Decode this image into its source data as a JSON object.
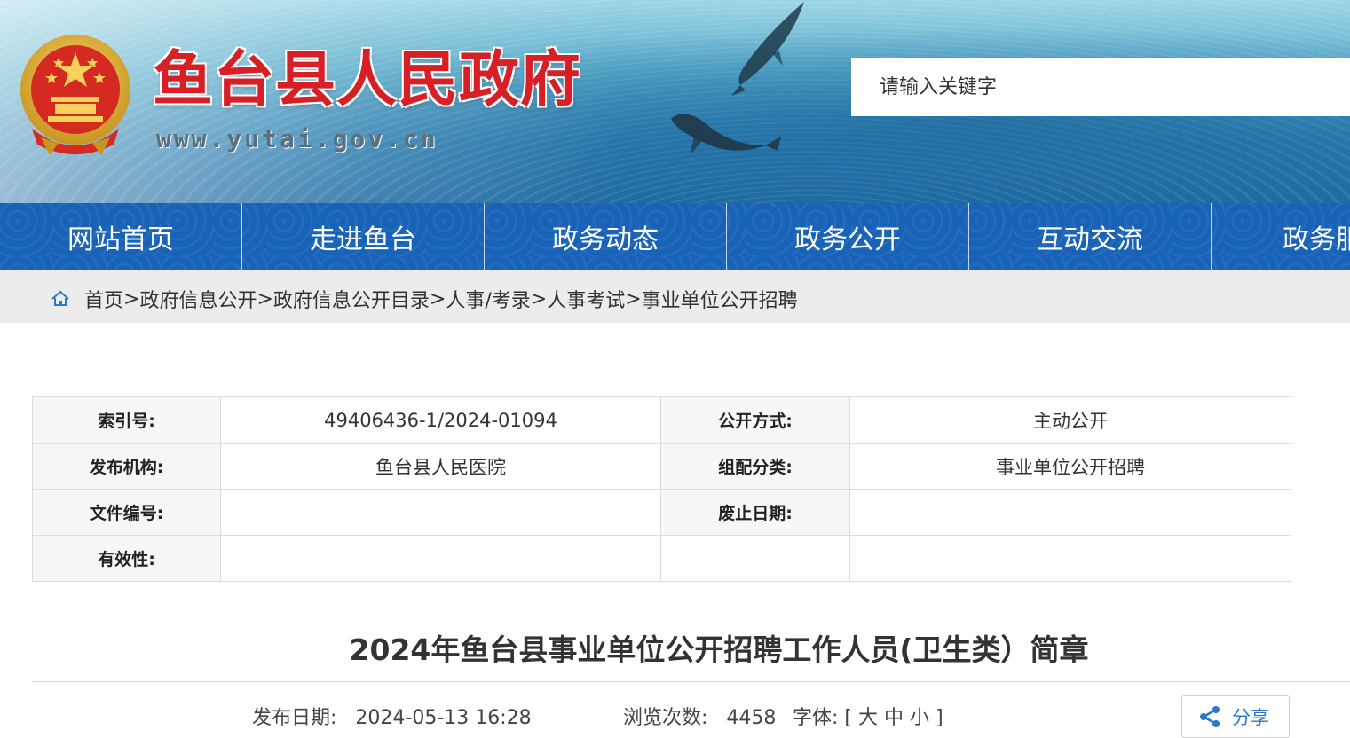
{
  "header": {
    "site_title": "鱼台县人民政府",
    "site_url": "www.yutai.gov.cn",
    "search_placeholder": "请输入关键字"
  },
  "nav": {
    "items": [
      "网站首页",
      "走进鱼台",
      "政务动态",
      "政务公开",
      "互动交流",
      "政务服"
    ]
  },
  "breadcrumb": {
    "items": [
      "首页",
      "政府信息公开",
      "政府信息公开目录",
      "人事/考录",
      "人事考试",
      "事业单位公开招聘"
    ],
    "separator": ">"
  },
  "meta": {
    "index_label": "索引号:",
    "index_value": "49406436-1/2024-01094",
    "open_mode_label": "公开方式:",
    "open_mode_value": "主动公开",
    "publisher_label": "发布机构:",
    "publisher_value": "鱼台县人民医院",
    "category_label": "组配分类:",
    "category_value": "事业单位公开招聘",
    "doc_no_label": "文件编号:",
    "doc_no_value": "",
    "expire_label": "废止日期:",
    "expire_value": "",
    "validity_label": "有效性:",
    "validity_value": ""
  },
  "article": {
    "title": "2024年鱼台县事业单位公开招聘工作人员(卫生类）简章",
    "publish_label": "发布日期:",
    "publish_value": "2024-05-13 16:28",
    "views_label": "浏览次数:",
    "views_value": "4458",
    "font_label": "字体:",
    "font_open": "[",
    "font_large": "大",
    "font_medium": "中",
    "font_small": "小",
    "font_close": "]",
    "share_label": "分享"
  },
  "colors": {
    "nav_blue": "#1863b7",
    "title_red": "#d81f26",
    "link_blue": "#2b79c9"
  }
}
